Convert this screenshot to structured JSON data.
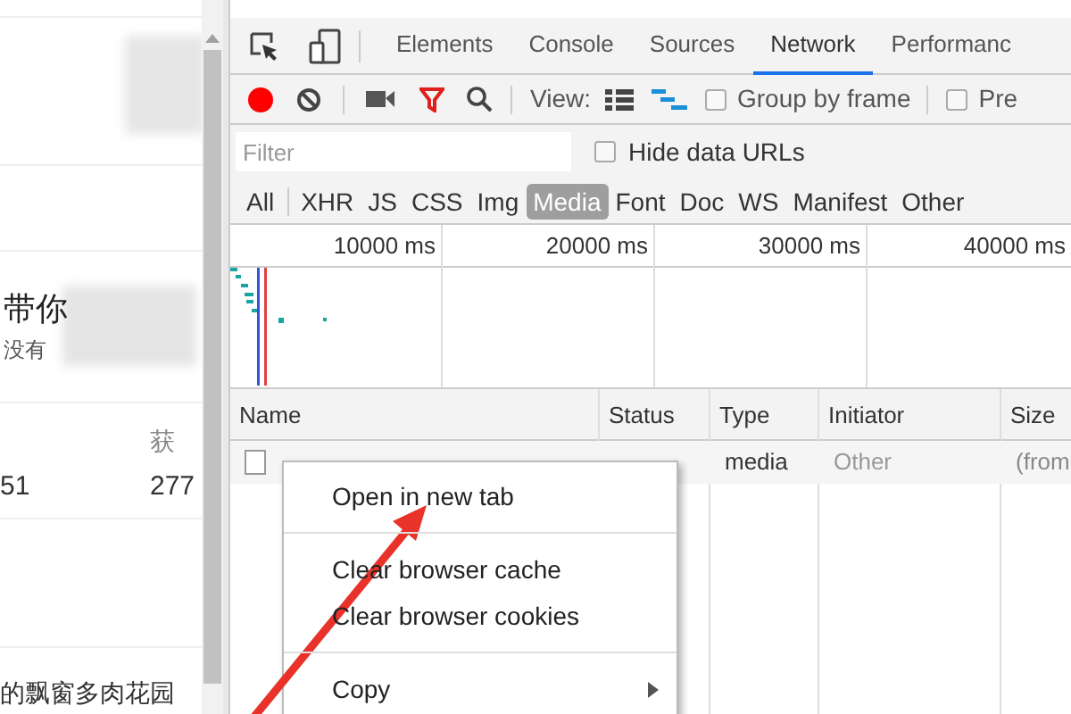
{
  "page": {
    "heading": "带你",
    "subheading": "没有",
    "stats": [
      {
        "value": "51"
      },
      {
        "label": "获",
        "value": "277"
      }
    ],
    "footer_text": "的飘窗多肉花园"
  },
  "devtools": {
    "tabs": [
      {
        "label": "Elements",
        "selected": false
      },
      {
        "label": "Console",
        "selected": false
      },
      {
        "label": "Sources",
        "selected": false
      },
      {
        "label": "Network",
        "selected": true
      },
      {
        "label": "Performanc",
        "selected": false
      }
    ],
    "recording": true,
    "view_label": "View:",
    "options": [
      {
        "label": "Group by frame",
        "checked": false
      },
      {
        "label": "Pre",
        "checked": false
      }
    ],
    "filter": {
      "placeholder": "Filter"
    },
    "hide_data_urls": {
      "label": "Hide data URLs",
      "checked": false
    },
    "type_filters": [
      {
        "label": "All",
        "selected": false
      },
      {
        "label": "XHR",
        "selected": false
      },
      {
        "label": "JS",
        "selected": false
      },
      {
        "label": "CSS",
        "selected": false
      },
      {
        "label": "Img",
        "selected": false
      },
      {
        "label": "Media",
        "selected": true
      },
      {
        "label": "Font",
        "selected": false
      },
      {
        "label": "Doc",
        "selected": false
      },
      {
        "label": "WS",
        "selected": false
      },
      {
        "label": "Manifest",
        "selected": false
      },
      {
        "label": "Other",
        "selected": false
      }
    ],
    "overview_ticks": [
      "10000 ms",
      "20000 ms",
      "30000 ms",
      "40000 ms"
    ],
    "table": {
      "columns": [
        "Name",
        "Status",
        "Type",
        "Initiator",
        "Size"
      ],
      "rows": [
        {
          "type": "media",
          "initiator": "Other",
          "size": "(from"
        }
      ]
    },
    "context_menu": {
      "groups": [
        [
          {
            "label": "Open in new tab",
            "submenu": false
          }
        ],
        [
          {
            "label": "Clear browser cache",
            "submenu": false
          },
          {
            "label": "Clear browser cookies",
            "submenu": false
          }
        ],
        [
          {
            "label": "Copy",
            "submenu": true
          }
        ]
      ]
    }
  }
}
